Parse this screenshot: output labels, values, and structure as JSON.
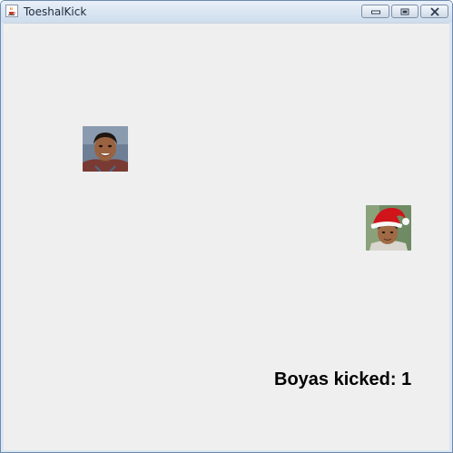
{
  "window": {
    "title": "ToeshalKick",
    "app_icon": "java-coffee-cup-icon",
    "buttons": {
      "minimize_icon": "minimize-icon",
      "maximize_icon": "maximize-icon",
      "close_icon": "close-icon"
    }
  },
  "game": {
    "background_color": "#efefef",
    "sprites": {
      "player": "boy-face-photo",
      "target": "boy-with-santa-hat-photo"
    },
    "score_text": "Boyas kicked: 1"
  }
}
